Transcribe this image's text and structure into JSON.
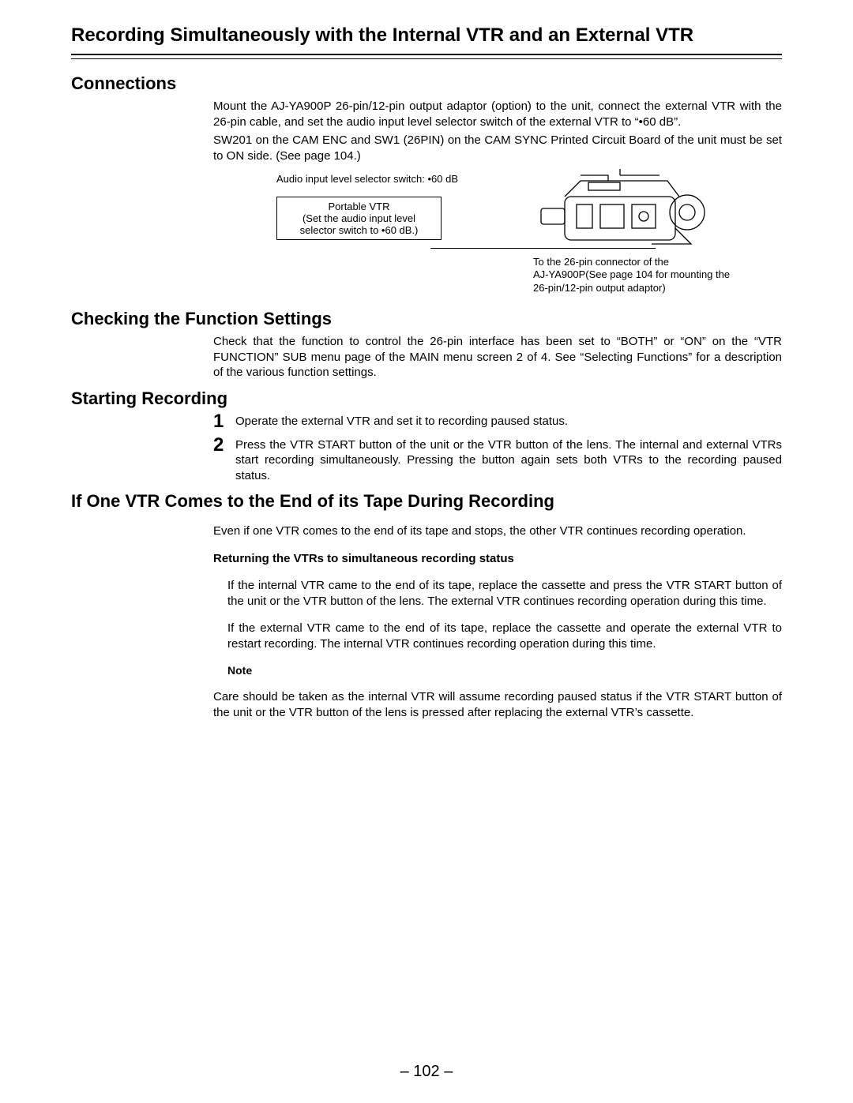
{
  "title": "Recording Simultaneously with the Internal VTR and an External VTR",
  "sections": {
    "connections": {
      "heading": "Connections",
      "p1": "Mount the AJ-YA900P 26-pin/12-pin output adaptor (option) to the unit, connect the external VTR with the 26-pin cable, and set the audio input level selector switch of the external VTR to “•60 dB”.",
      "p2": "SW201 on the CAM ENC and SW1 (26PIN) on the CAM SYNC Printed Circuit Board of the unit must be set to ON side. (See page 104.)",
      "diagram": {
        "audio_line": "Audio input level selector switch: •60 dB",
        "portable_line1": "Portable VTR",
        "portable_line2": "(Set the audio input level",
        "portable_line3": "selector switch to •60 dB.)",
        "caption_l1": "To the 26-pin connector of the",
        "caption_l2": "AJ-YA900P(See page 104 for mounting the",
        "caption_l3": "26-pin/12-pin output adaptor)"
      }
    },
    "checking": {
      "heading": "Checking the Function Settings",
      "p1": "Check that the function to control the 26-pin interface has been set to “BOTH” or “ON” on the “VTR FUNCTION” SUB menu page of the MAIN menu screen 2 of 4. See “Selecting Functions” for a description of the various function settings."
    },
    "starting": {
      "heading": "Starting Recording",
      "steps": [
        {
          "n": "1",
          "text": "Operate the external VTR and set it to recording paused status."
        },
        {
          "n": "2",
          "text": "Press the VTR START button of the unit or the VTR button of the lens. The internal and external VTRs start recording simultaneously. Pressing the button again sets both VTRs to the recording paused status."
        }
      ]
    },
    "endtape": {
      "heading": "If One VTR Comes to the End of its Tape During Recording",
      "p1": "Even if one VTR comes to the end of its tape and stops, the other VTR continues recording operation.",
      "sub_heading": "Returning the VTRs to simultaneous recording status",
      "p2": "If the internal VTR came to the end of its tape, replace the cassette and press the VTR START button of the unit or the VTR button of the lens. The external VTR continues recording operation during this time.",
      "p3": "If the external VTR came to the end of its tape, replace the cassette and operate the external VTR to restart recording. The internal VTR continues recording operation during this time.",
      "note_label": "Note",
      "note": "Care should be taken as the internal VTR will assume recording paused status if the VTR START button of the unit or the VTR button of the lens is pressed after replacing the external VTR’s cassette."
    }
  },
  "page_number": "– 102 –"
}
